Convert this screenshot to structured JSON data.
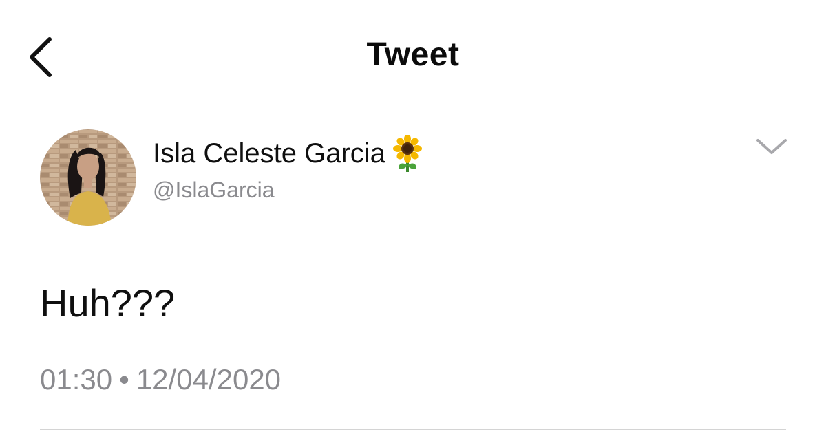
{
  "header": {
    "title": "Tweet",
    "back_icon": "chevron-left-icon"
  },
  "tweet": {
    "author": {
      "display_name": "Isla Celeste Garcia",
      "emoji": "🌻",
      "handle": "@IslaGarcia",
      "avatar_icon": "avatar-photo"
    },
    "menu_icon": "chevron-down-icon",
    "text": "Huh???",
    "time": "01:30",
    "separator": "•",
    "date": "12/04/2020"
  },
  "colors": {
    "text_primary": "#0f0f0f",
    "text_secondary": "#8a8a8e",
    "divider": "#cfcfcf",
    "background": "#ffffff"
  }
}
